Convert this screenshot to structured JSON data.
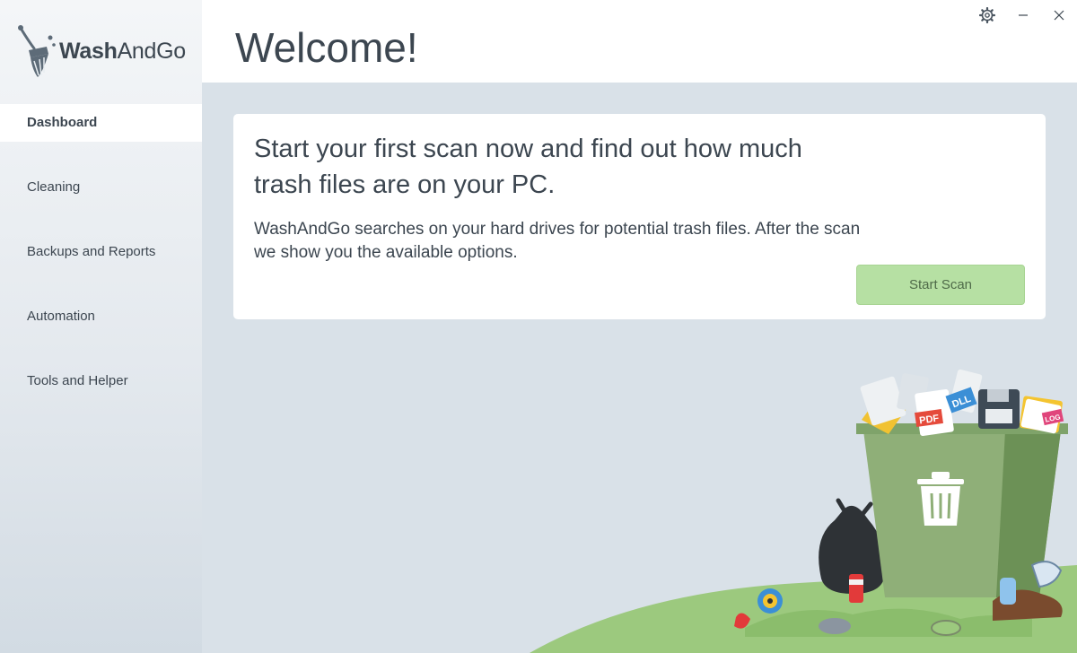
{
  "app": {
    "logo_bold": "Wash",
    "logo_regular": "AndGo"
  },
  "sidebar": {
    "items": [
      {
        "label": "Dashboard",
        "active": true
      },
      {
        "label": "Cleaning",
        "active": false
      },
      {
        "label": "Backups and Reports",
        "active": false
      },
      {
        "label": "Automation",
        "active": false
      },
      {
        "label": "Tools and Helper",
        "active": false
      }
    ]
  },
  "header": {
    "title": "Welcome!",
    "controls": [
      "gear-icon",
      "minimize-icon",
      "close-icon"
    ]
  },
  "card": {
    "heading": "Start your first scan now and find out how much trash files are on your PC.",
    "body": "WashAndGo searches on your hard drives for potential trash files. After the scan we show you the available options.",
    "button_label": "Start Scan"
  },
  "illustration": {
    "file_labels": [
      "PDF",
      "DLL",
      "LOG"
    ]
  },
  "colors": {
    "accent_green": "#b6e0a3",
    "background": "#d9e1e8",
    "text": "#3c4650"
  }
}
